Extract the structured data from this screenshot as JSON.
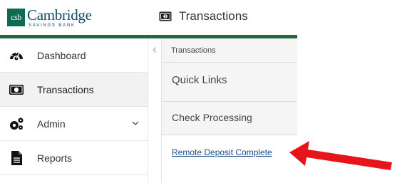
{
  "brand": {
    "logo_mark": "csb",
    "name": "Cambridge",
    "tagline": "SAVINGS BANK",
    "green": "#1d6b3f"
  },
  "header": {
    "title": "Transactions",
    "icon": "money-icon"
  },
  "sidebar": {
    "items": [
      {
        "label": "Dashboard",
        "icon": "dashboard-icon",
        "active": false
      },
      {
        "label": "Transactions",
        "icon": "money-icon",
        "active": true
      },
      {
        "label": "Admin",
        "icon": "gears-icon",
        "active": false,
        "has_submenu": true
      },
      {
        "label": "Reports",
        "icon": "document-icon",
        "active": false
      }
    ]
  },
  "subnav": {
    "breadcrumb": "Transactions",
    "quick_links": "Quick Links",
    "check_processing": "Check Processing",
    "remote_deposit": "Remote Deposit Complete",
    "link_color": "#1a4f8b"
  },
  "annotation": {
    "arrow_color": "#e8141b"
  }
}
